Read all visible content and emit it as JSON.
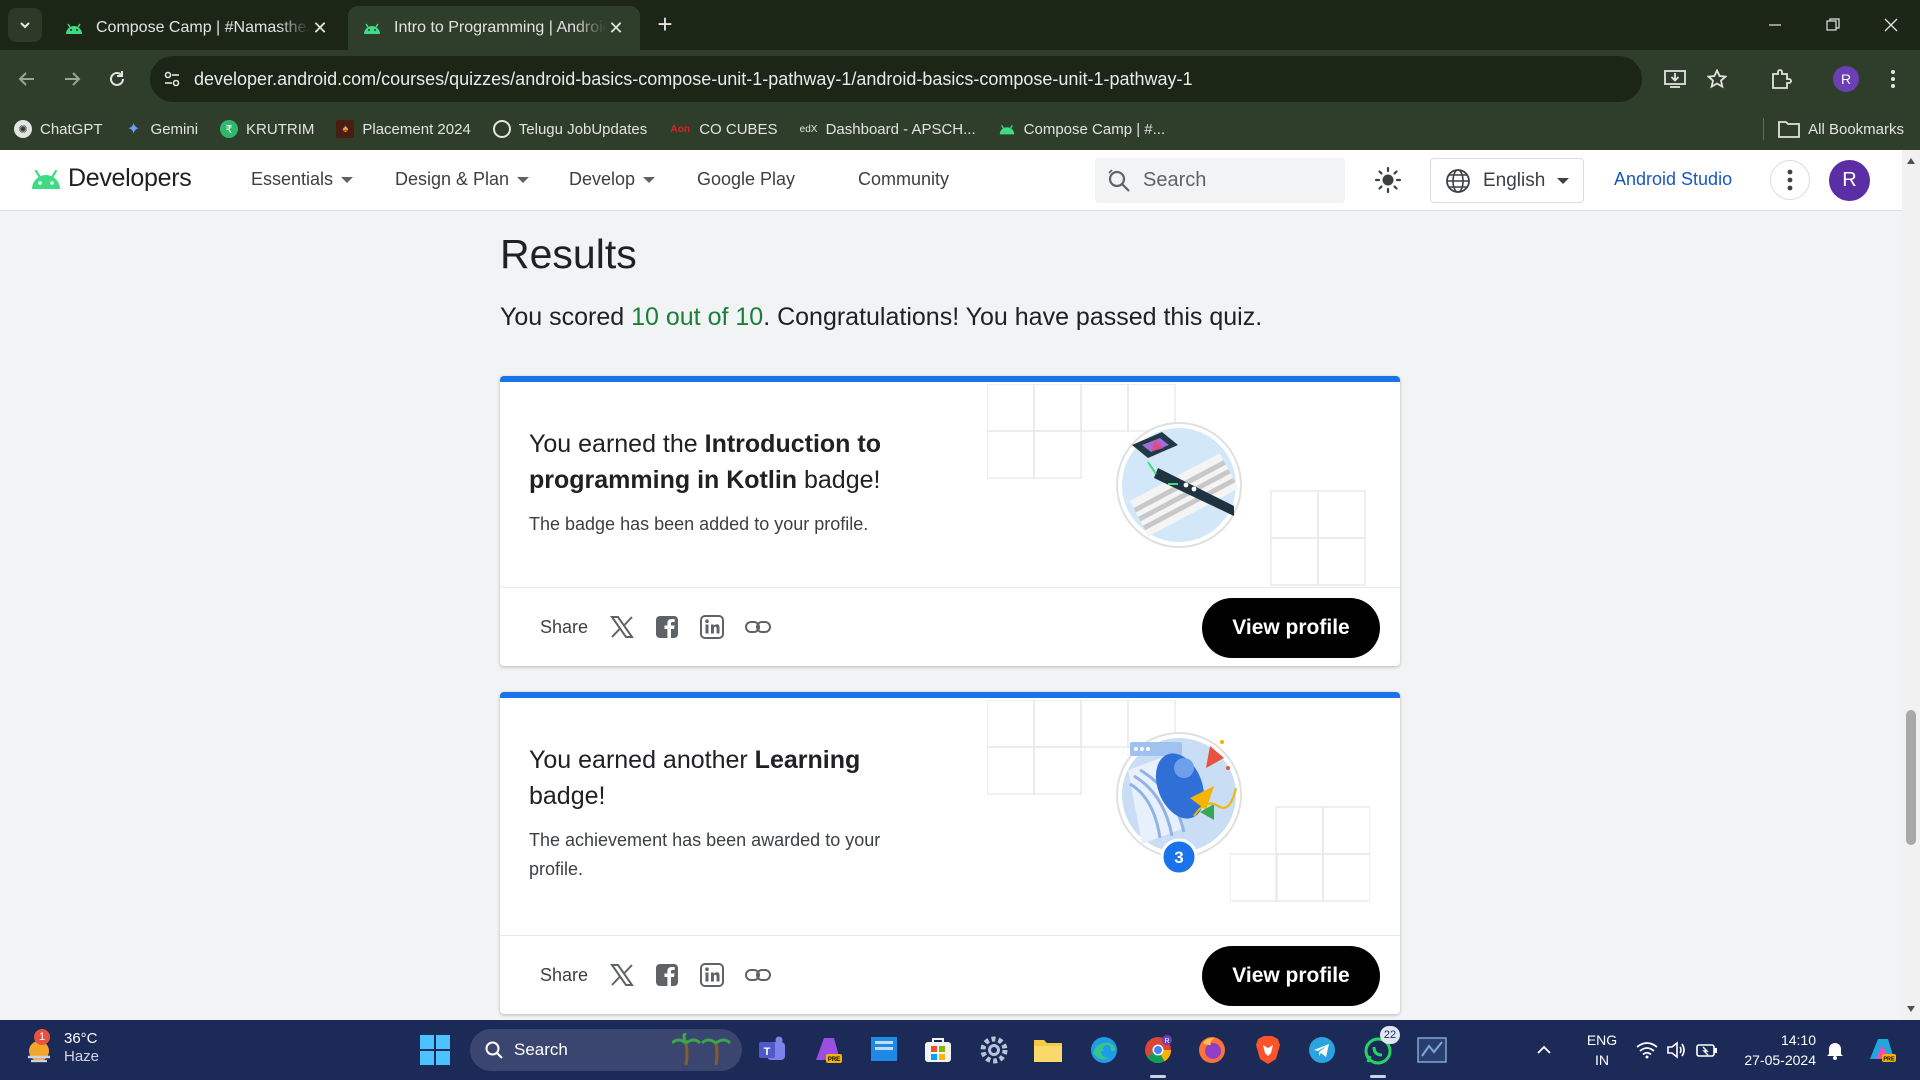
{
  "browser": {
    "tabs": [
      {
        "title": "Compose Camp | #NamastheAndroid",
        "active": false
      },
      {
        "title": "Intro to Programming | Android Developers",
        "active": true
      }
    ],
    "url": "developer.android.com/courses/quizzes/android-basics-compose-unit-1-pathway-1/android-basics-compose-unit-1-pathway-1",
    "profile_initial": "R",
    "bookmarks": [
      {
        "label": "ChatGPT",
        "icon": "chatgpt-icon"
      },
      {
        "label": "Gemini",
        "icon": "gemini-icon"
      },
      {
        "label": "KRUTRIM",
        "icon": "krutrim-icon"
      },
      {
        "label": "Placement 2024",
        "icon": "placement-icon"
      },
      {
        "label": "Telugu JobUpdates",
        "icon": "globe-icon"
      },
      {
        "label": "CO CUBES",
        "icon": "cocubes-icon"
      },
      {
        "label": "Dashboard - APSCH...",
        "icon": "edx-icon"
      },
      {
        "label": "Compose Camp | #...",
        "icon": "android-icon"
      }
    ],
    "all_bookmarks": "All Bookmarks"
  },
  "header": {
    "logo_text": "Developers",
    "nav": [
      {
        "label": "Essentials",
        "dropdown": true
      },
      {
        "label": "Design & Plan",
        "dropdown": true
      },
      {
        "label": "Develop",
        "dropdown": true
      },
      {
        "label": "Google Play",
        "dropdown": false
      },
      {
        "label": "Community",
        "dropdown": false
      }
    ],
    "search_placeholder": "Search",
    "language": "English",
    "studio_link": "Android Studio",
    "avatar_initial": "R"
  },
  "results": {
    "title": "Results",
    "prefix": "You scored ",
    "score": "10 out of 10",
    "suffix": ". Congratulations! You have passed this quiz."
  },
  "cards": [
    {
      "heading_prefix": "You earned the ",
      "heading_bold": "Introduction to programming in Kotlin",
      "heading_suffix": " badge!",
      "description": "The badge has been added to your profile.",
      "share_label": "Share",
      "button": "View profile"
    },
    {
      "heading_prefix": "You earned another ",
      "heading_bold": "Learning",
      "heading_suffix": " badge!",
      "description": "The achievement has been awarded to your profile.",
      "badge_count": "3",
      "share_label": "Share",
      "button": "View profile"
    }
  ],
  "taskbar": {
    "weather_temp": "36°C",
    "weather_cond": "Haze",
    "weather_alert": "1",
    "search_label": "Search",
    "whatsapp_badge": "22",
    "lang_line1": "ENG",
    "lang_line2": "IN",
    "time": "14:10",
    "date": "27-05-2024"
  },
  "colors": {
    "accent_blue": "#1a73e8",
    "score_green": "#188038",
    "chrome_dark": "#1b2617",
    "chrome_toolbar": "#2f3e2a",
    "taskbar": "#1c2a57"
  }
}
